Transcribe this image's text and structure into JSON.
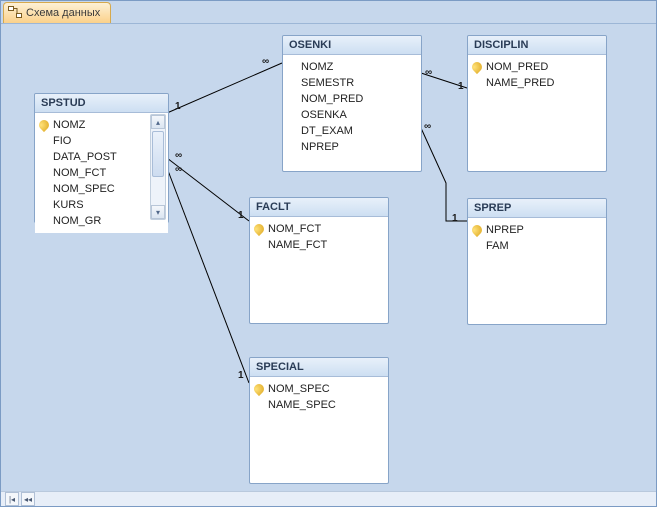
{
  "tab": {
    "title": "Схема данных"
  },
  "tables": {
    "spstud": {
      "title": "SPSTUD",
      "fields": [
        "NOMZ",
        "FIO",
        "DATA_POST",
        "NOM_FCT",
        "NOM_SPEC",
        "KURS",
        "NOM_GR"
      ],
      "keyFields": [
        "NOMZ"
      ]
    },
    "osenki": {
      "title": "OSENKI",
      "fields": [
        "NOMZ",
        "SEMESTR",
        "NOM_PRED",
        "OSENKA",
        "DT_EXAM",
        "NPREP"
      ],
      "keyFields": []
    },
    "disciplin": {
      "title": "DISCIPLIN",
      "fields": [
        "NOM_PRED",
        "NAME_PRED"
      ],
      "keyFields": [
        "NOM_PRED"
      ]
    },
    "faclt": {
      "title": "FACLT",
      "fields": [
        "NOM_FCT",
        "NAME_FCT"
      ],
      "keyFields": [
        "NOM_FCT"
      ]
    },
    "sprep": {
      "title": "SPREP",
      "fields": [
        "NPREP",
        "FAM"
      ],
      "keyFields": [
        "NPREP"
      ]
    },
    "special": {
      "title": "SPECIAL",
      "fields": [
        "NOM_SPEC",
        "NAME_SPEC"
      ],
      "keyFields": [
        "NOM_SPEC"
      ]
    }
  },
  "relations": {
    "spstud_osenki": {
      "left": "1",
      "right": "∞"
    },
    "spstud_faclt": {
      "left": "∞",
      "right": "1"
    },
    "spstud_special": {
      "left": "∞",
      "right": "1"
    },
    "osenki_disciplin": {
      "left": "∞",
      "right": "1"
    },
    "osenki_sprep": {
      "left": "∞",
      "right": "1"
    }
  },
  "colors": {
    "canvas": "#c6d7ec",
    "tableHeader": "#cddff2",
    "tableBorder": "#87a4c8"
  },
  "status": {
    "navFirst": "|◂",
    "navPrev": "◂◂"
  }
}
